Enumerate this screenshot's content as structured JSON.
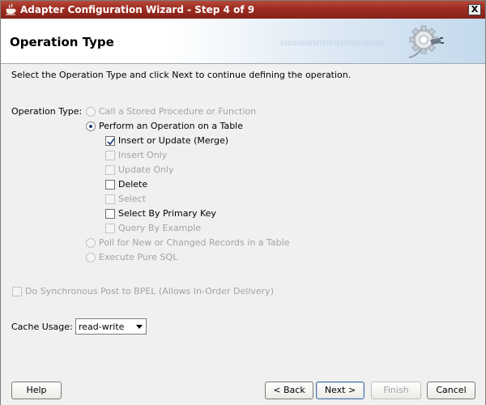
{
  "window": {
    "title": "Adapter Configuration Wizard - Step 4 of 9",
    "close_label": "X"
  },
  "banner": {
    "title": "Operation Type",
    "binary_text": "010101010101010101010101010101"
  },
  "instruction": "Select the Operation Type and click Next to continue defining the operation.",
  "operation_type": {
    "label": "Operation Type:",
    "options": [
      {
        "label": "Call a Stored Procedure or Function",
        "selected": false,
        "enabled": false
      },
      {
        "label": "Perform an Operation on a Table",
        "selected": true,
        "enabled": true
      },
      {
        "label": "Poll for New or Changed Records in a Table",
        "selected": false,
        "enabled": false
      },
      {
        "label": "Execute Pure SQL",
        "selected": false,
        "enabled": false
      }
    ],
    "table_operations": [
      {
        "label": "Insert or Update (Merge)",
        "checked": true,
        "enabled": true
      },
      {
        "label": "Insert Only",
        "checked": false,
        "enabled": false
      },
      {
        "label": "Update Only",
        "checked": false,
        "enabled": false
      },
      {
        "label": "Delete",
        "checked": false,
        "enabled": true
      },
      {
        "label": "Select",
        "checked": false,
        "enabled": false
      },
      {
        "label": "Select By Primary Key",
        "checked": false,
        "enabled": true
      },
      {
        "label": "Query By Example",
        "checked": false,
        "enabled": false
      }
    ]
  },
  "sync_post": {
    "label": "Do Synchronous Post to BPEL (Allows In-Order Delivery)",
    "checked": false,
    "enabled": false
  },
  "cache_usage": {
    "label": "Cache Usage:",
    "value": "read-write"
  },
  "buttons": {
    "help": "Help",
    "back": "< Back",
    "next": "Next >",
    "finish": "Finish",
    "cancel": "Cancel"
  },
  "colors": {
    "titlebar": "#9c2b20",
    "disabled_text": "#a3a3a3",
    "dialog_bg": "#f0f0ee"
  }
}
